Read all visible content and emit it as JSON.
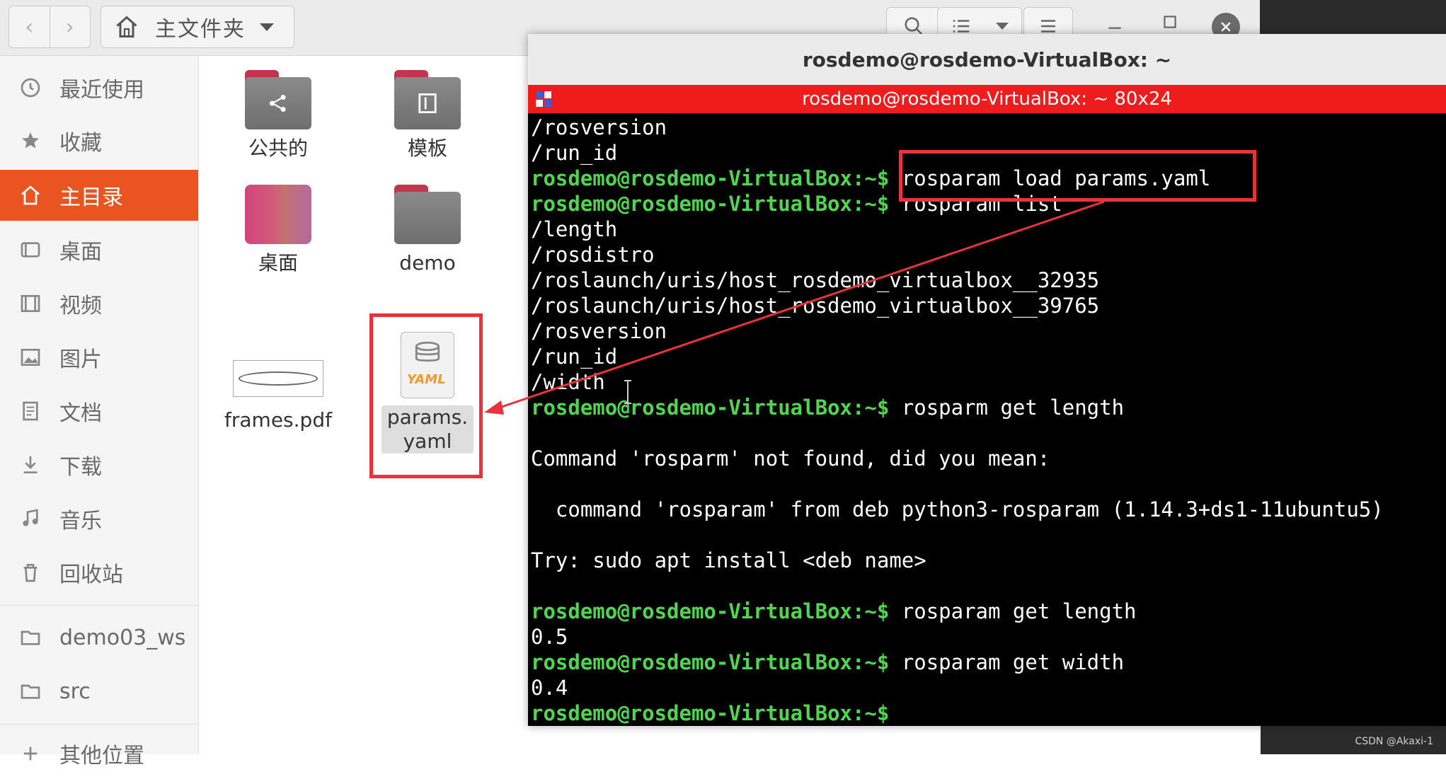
{
  "file_manager": {
    "nav_back": "‹",
    "nav_forward": "›",
    "path_label": "主文件夹",
    "sidebar": [
      {
        "label": "最近使用",
        "icon": "clock-icon"
      },
      {
        "label": "收藏",
        "icon": "star-icon"
      },
      {
        "label": "主目录",
        "icon": "home-icon",
        "active": true
      },
      {
        "label": "桌面",
        "icon": "desktop-icon"
      },
      {
        "label": "视频",
        "icon": "video-icon"
      },
      {
        "label": "图片",
        "icon": "picture-icon"
      },
      {
        "label": "文档",
        "icon": "document-icon"
      },
      {
        "label": "下载",
        "icon": "download-icon"
      },
      {
        "label": "音乐",
        "icon": "music-icon"
      },
      {
        "label": "回收站",
        "icon": "trash-icon"
      },
      {
        "label": "demo03_ws",
        "icon": "folder-icon"
      },
      {
        "label": "src",
        "icon": "folder-icon"
      },
      {
        "label": "其他位置",
        "icon": "plus-icon"
      }
    ],
    "files": [
      {
        "label": "公共的",
        "icon": "share-folder-icon"
      },
      {
        "label": "模板",
        "icon": "template-folder-icon"
      },
      {
        "label": "桌面",
        "icon": "desktop-folder-icon"
      },
      {
        "label": "demo",
        "icon": "folder-icon"
      },
      {
        "label": "frames.pdf",
        "icon": "pdf-file-icon"
      },
      {
        "label": "params.\nyaml",
        "icon": "yaml-file-icon",
        "selected": true
      }
    ]
  },
  "terminal": {
    "window_title": "rosdemo@rosdemo-VirtualBox: ~",
    "tab_title": "rosdemo@rosdemo-VirtualBox: ~ 80x24",
    "prompt": "rosdemo@rosdemo-VirtualBox:~$",
    "lines": [
      {
        "text": "/rosversion"
      },
      {
        "text": "/run_id"
      },
      {
        "prompt": true,
        "cmd": " rosparam load params.yaml"
      },
      {
        "prompt": true,
        "cmd": " rosparam list"
      },
      {
        "text": "/length"
      },
      {
        "text": "/rosdistro"
      },
      {
        "text": "/roslaunch/uris/host_rosdemo_virtualbox__32935"
      },
      {
        "text": "/roslaunch/uris/host_rosdemo_virtualbox__39765"
      },
      {
        "text": "/rosversion"
      },
      {
        "text": "/run_id"
      },
      {
        "text": "/width"
      },
      {
        "prompt": true,
        "cmd": " rosparm get length"
      },
      {
        "text": ""
      },
      {
        "text": "Command 'rosparm' not found, did you mean:"
      },
      {
        "text": ""
      },
      {
        "text": "  command 'rosparam' from deb python3-rosparam (1.14.3+ds1-11ubuntu5)"
      },
      {
        "text": ""
      },
      {
        "text": "Try: sudo apt install <deb name>"
      },
      {
        "text": ""
      },
      {
        "prompt": true,
        "cmd": " rosparam get length"
      },
      {
        "text": "0.5"
      },
      {
        "prompt": true,
        "cmd": " rosparam get width"
      },
      {
        "text": "0.4"
      },
      {
        "prompt": true,
        "cmd": ""
      }
    ]
  },
  "watermark": "CSDN @Akaxi-1",
  "colors": {
    "accent": "#e95420",
    "prompt_green": "#4fd64f",
    "terminal_red": "#ee1c1c",
    "annotation_red": "#e8323c"
  }
}
